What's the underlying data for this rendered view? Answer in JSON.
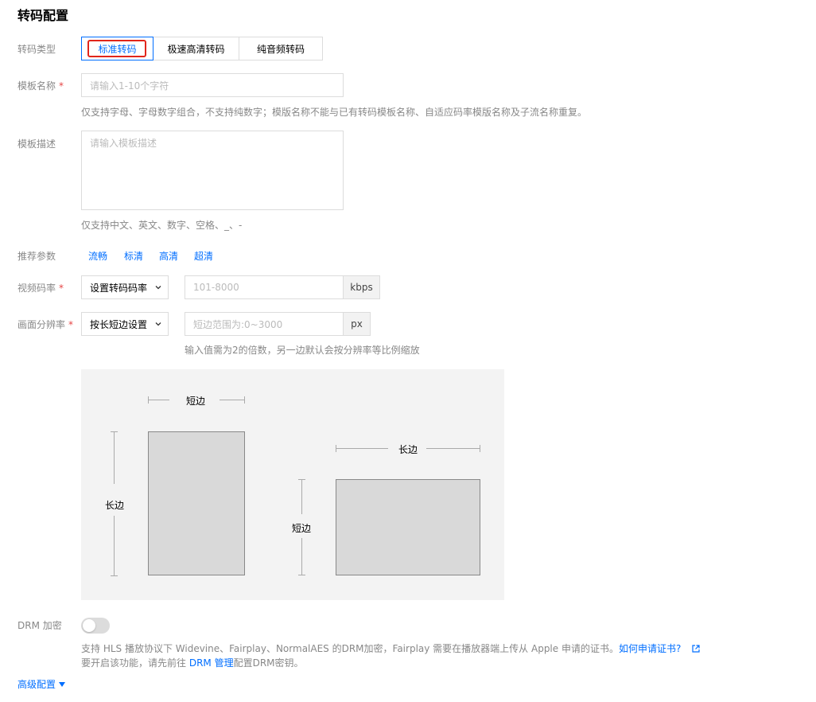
{
  "page": {
    "title": "转码配置"
  },
  "transcode_type": {
    "label": "转码类型",
    "options": [
      "标准转码",
      "极速高清转码",
      "纯音频转码"
    ],
    "selected": "标准转码"
  },
  "template_name": {
    "label": "模板名称",
    "required_mark": "*",
    "placeholder": "请输入1-10个字符",
    "value": "",
    "help": "仅支持字母、字母数字组合，不支持纯数字；模版名称不能与已有转码模板名称、自适应码率模版名称及子流名称重复。"
  },
  "template_desc": {
    "label": "模板描述",
    "placeholder": "请输入模板描述",
    "value": "",
    "help": "仅支持中文、英文、数字、空格、_、-"
  },
  "presets": {
    "label": "推荐参数",
    "items": [
      "流畅",
      "标清",
      "高清",
      "超清"
    ]
  },
  "video_bitrate": {
    "label": "视频码率",
    "required_mark": "*",
    "select_value": "设置转码码率",
    "placeholder": "101-8000",
    "unit": "kbps"
  },
  "resolution": {
    "label": "画面分辨率",
    "required_mark": "*",
    "select_value": "按长短边设置",
    "placeholder": "短边范围为:0~3000",
    "unit": "px",
    "help": "输入值需为2的倍数，另一边默认会按分辨率等比例缩放"
  },
  "diagram": {
    "left": {
      "top_label": "短边",
      "side_label": "长边"
    },
    "right": {
      "top_label": "长边",
      "side_label": "短边"
    }
  },
  "drm": {
    "label": "DRM 加密",
    "enabled": false,
    "line1_text": "支持 HLS 播放协议下 Widevine、Fairplay、NormalAES 的DRM加密，Fairplay 需要在播放器端上传从 Apple 申请的证书。",
    "line1_link": "如何申请证书?",
    "line2_prefix": "要开启该功能，请先前往 ",
    "line2_link": "DRM 管理",
    "line2_suffix": "配置DRM密钥。"
  },
  "advanced": {
    "label": "高级配置"
  },
  "colors": {
    "accent": "#006eff",
    "highlight": "#e1251b",
    "required": "#e54545"
  }
}
